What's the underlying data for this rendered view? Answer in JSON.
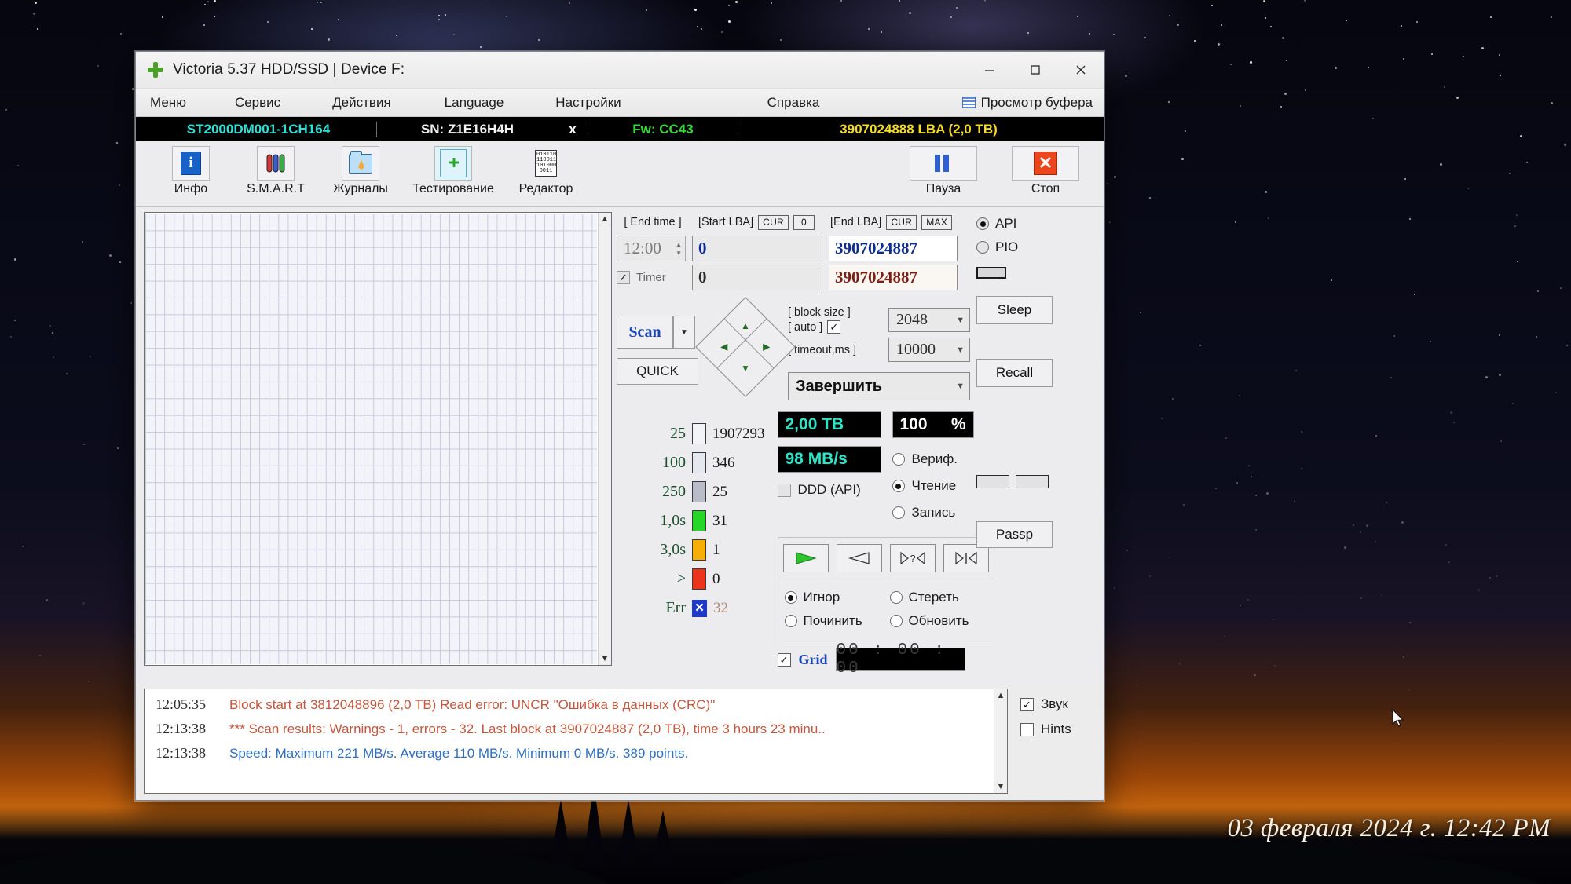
{
  "desktop": {
    "clock": "03 февраля 2024 г. 12:42 PM"
  },
  "window": {
    "title": "Victoria 5.37 HDD/SSD | Device F:",
    "icon": "victoria-cross-icon",
    "controls": {
      "minimize": "minimize-icon",
      "maximize": "maximize-icon",
      "close": "close-icon"
    }
  },
  "menu": {
    "items": [
      "Меню",
      "Сервис",
      "Действия",
      "Language",
      "Настройки",
      "Справка"
    ],
    "buffer_label": "Просмотр буфера"
  },
  "device": {
    "model": "ST2000DM001-1CH164",
    "serial": "SN: Z1E16H4H",
    "x": "x",
    "firmware": "Fw: CC43",
    "capacity": "3907024888 LBA (2,0 TB)"
  },
  "toolbar": {
    "buttons": [
      {
        "label": "Инфо",
        "icon": "info-icon"
      },
      {
        "label": "S.M.A.R.T",
        "icon": "test-tubes-icon"
      },
      {
        "label": "Журналы",
        "icon": "folder-icon"
      },
      {
        "label": "Тестирование",
        "icon": "test-plus-icon"
      },
      {
        "label": "Редактор",
        "icon": "binary-editor-icon"
      }
    ],
    "right": [
      {
        "label": "Пауза",
        "icon": "pause-icon"
      },
      {
        "label": "Стоп",
        "icon": "stop-icon"
      }
    ]
  },
  "params": {
    "end_time_label": "[ End time ]",
    "end_time_value": "12:00",
    "timer_label": "Timer",
    "timer_checked": true,
    "start_lba_label": "[Start LBA]",
    "start_cur_btn": "CUR",
    "start_zero_btn": "0",
    "start_lba_value": "0",
    "start_lba_value2": "0",
    "end_lba_label": "[End LBA]",
    "end_cur_btn": "CUR",
    "end_max_btn": "MAX",
    "end_lba_value": "3907024887",
    "end_lba_value2": "3907024887"
  },
  "scan": {
    "scan_btn": "Scan",
    "quick_btn": "QUICK",
    "dpad": {
      "up": "▲",
      "down": "▼",
      "left": "◀",
      "right": "▶"
    },
    "block_size_label": "[ block size ]",
    "auto_label": "[ auto ]",
    "auto_checked": true,
    "block_size_value": "2048",
    "timeout_label": "[ timeout,ms ]",
    "timeout_value": "10000",
    "finish_action": "Завершить"
  },
  "legend": {
    "rows": [
      {
        "threshold": "25",
        "color": "#f2f3f7",
        "count": "1907293"
      },
      {
        "threshold": "100",
        "color": "#e6e8ef",
        "count": "346"
      },
      {
        "threshold": "250",
        "color": "#b9bcc9",
        "count": "25"
      },
      {
        "threshold": "1,0s",
        "color": "#28d629",
        "count": "31"
      },
      {
        "threshold": "3,0s",
        "color": "#f6ae09",
        "count": "1"
      },
      {
        "threshold": ">",
        "color": "#e8351a",
        "count": "0"
      }
    ],
    "err_label": "Err",
    "err_count": "32"
  },
  "stats": {
    "capacity": "2,00 TB",
    "percent_value": "100",
    "percent_sign": "%",
    "speed": "98 MB/s",
    "ddd_label": "DDD (API)",
    "ddd_checked": false,
    "modes": [
      {
        "label": "Вериф.",
        "selected": false
      },
      {
        "label": "Чтение",
        "selected": true
      },
      {
        "label": "Запись",
        "selected": false
      }
    ],
    "transport": [
      {
        "icon": "play-icon",
        "active": true
      },
      {
        "icon": "play-back-icon",
        "active": false
      },
      {
        "icon": "jump-query-icon",
        "active": false
      },
      {
        "icon": "jump-end-icon",
        "active": false
      }
    ],
    "actions": [
      {
        "label": "Игнор",
        "selected": true
      },
      {
        "label": "Стереть",
        "selected": false
      },
      {
        "label": "Починить",
        "selected": false
      },
      {
        "label": "Обновить",
        "selected": false
      }
    ],
    "grid_label": "Grid",
    "grid_checked": true,
    "timer_display": "00 : 00 : 00"
  },
  "side": {
    "api_label": "API",
    "pio_label": "PIO",
    "api_selected": true,
    "pio_selected": false,
    "sleep_btn": "Sleep",
    "recall_btn": "Recall",
    "passp_btn": "Passp"
  },
  "log": {
    "lines": [
      {
        "time": "12:05:35",
        "text": "Block start at 3812048896 (2,0 TB) Read error: UNCR \"Ошибка в данных (CRC)\"",
        "color": "red"
      },
      {
        "time": "12:13:38",
        "text": "*** Scan results: Warnings - 1, errors - 32. Last block at 3907024887 (2,0 TB), time 3 hours 23 minu..",
        "color": "red"
      },
      {
        "time": "12:13:38",
        "text": "Speed: Maximum 221 MB/s. Average 110 MB/s. Minimum 0 MB/s. 389 points.",
        "color": "blue"
      }
    ]
  },
  "footer": {
    "sound_label": "Звук",
    "sound_checked": true,
    "hints_label": "Hints",
    "hints_checked": false
  }
}
